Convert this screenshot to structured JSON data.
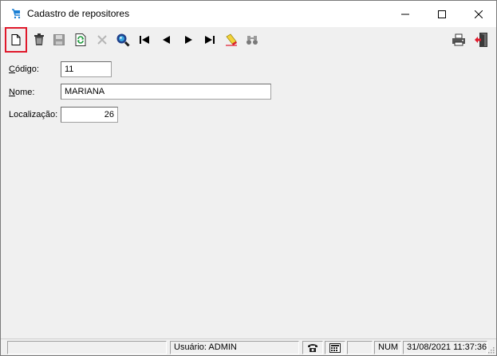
{
  "window": {
    "title": "Cadastro de repositores"
  },
  "toolbar": {
    "buttons": [
      {
        "name": "new",
        "icon": "new-document-icon"
      },
      {
        "name": "delete",
        "icon": "trash-icon"
      },
      {
        "name": "save",
        "icon": "save-icon"
      },
      {
        "name": "refresh",
        "icon": "refresh-icon"
      },
      {
        "name": "cancel",
        "icon": "cancel-icon"
      },
      {
        "name": "search",
        "icon": "search-icon"
      },
      {
        "name": "first",
        "icon": "first-record-icon"
      },
      {
        "name": "previous",
        "icon": "previous-record-icon"
      },
      {
        "name": "next",
        "icon": "next-record-icon"
      },
      {
        "name": "last",
        "icon": "last-record-icon"
      },
      {
        "name": "clear-filter",
        "icon": "eraser-icon"
      },
      {
        "name": "find",
        "icon": "binoculars-icon"
      },
      {
        "name": "print",
        "icon": "printer-icon"
      },
      {
        "name": "exit",
        "icon": "exit-door-icon"
      }
    ],
    "highlight_color": "#e0192b"
  },
  "form": {
    "codigo": {
      "label_first": "C",
      "label_rest": "ódigo:",
      "value": "11"
    },
    "nome": {
      "label_first": "N",
      "label_rest": "ome:",
      "value": "MARIANA"
    },
    "localizacao": {
      "label": "Localização:",
      "value": "26"
    }
  },
  "statusbar": {
    "user": "Usuário: ADMIN",
    "phone_icon": "telephone-icon",
    "calc_icon": "calculator-icon",
    "num": "NUM",
    "datetime": "31/08/2021 11:37:36."
  }
}
